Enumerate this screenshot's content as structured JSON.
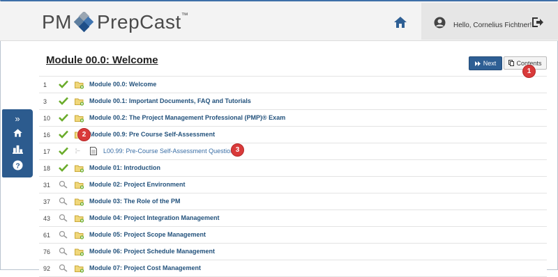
{
  "header": {
    "logo_pm": "PM",
    "logo_prepcast": "PrepCast",
    "logo_tm": "™",
    "greeting": "Hello, Cornelius Fichtner!"
  },
  "page": {
    "title": "Module 00.0: Welcome",
    "next_label": "Next",
    "contents_label": "Contents"
  },
  "markers": [
    "1",
    "2",
    "3"
  ],
  "sidebar": {
    "expand_glyph": "»"
  },
  "rows": [
    {
      "num": "1",
      "label": "Module 00.0: Welcome",
      "status": "done"
    },
    {
      "num": "3",
      "label": "Module 00.1: Important Documents, FAQ and Tutorials",
      "status": "done"
    },
    {
      "num": "10",
      "label": "Module 00.2: The Project Management Professional (PMP)® Exam",
      "status": "done"
    },
    {
      "num": "16",
      "label": "Module 00.9: Pre Course Self-Assessment",
      "status": "done"
    },
    {
      "num": "17",
      "label": "L00.99: Pre-Course Self-Assessment Questions",
      "status": "done",
      "sub": true
    },
    {
      "num": "18",
      "label": "Module 01: Introduction",
      "status": "done"
    },
    {
      "num": "31",
      "label": "Module 02: Project Environment",
      "status": "todo"
    },
    {
      "num": "37",
      "label": "Module 03: The Role of the PM",
      "status": "todo"
    },
    {
      "num": "43",
      "label": "Module 04: Project Integration Management",
      "status": "todo"
    },
    {
      "num": "61",
      "label": "Module 05: Project Scope Management",
      "status": "todo"
    },
    {
      "num": "76",
      "label": "Module 06: Project Schedule Management",
      "status": "todo"
    },
    {
      "num": "92",
      "label": "Module 07: Project Cost Management",
      "status": "todo"
    }
  ],
  "colors": {
    "brand_blue": "#2e5f94",
    "check_green": "#6aac2b",
    "marker_red": "#d93a3a",
    "link_blue": "#23527c"
  }
}
